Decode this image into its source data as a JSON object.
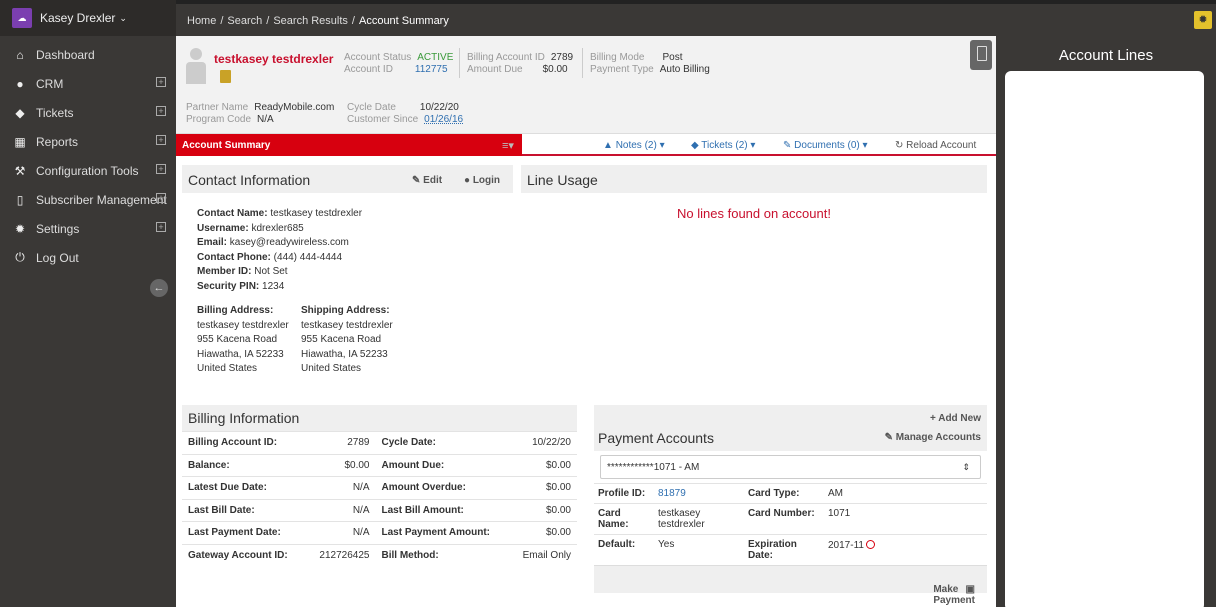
{
  "sidebar": {
    "user_name": "Kasey Drexler",
    "user_chevron": "⌄",
    "items": [
      {
        "label": "Dashboard",
        "icon": "home-icon",
        "expandable": false
      },
      {
        "label": "CRM",
        "icon": "user-icon",
        "expandable": true
      },
      {
        "label": "Tickets",
        "icon": "tag-icon",
        "expandable": true
      },
      {
        "label": "Reports",
        "icon": "table-icon",
        "expandable": true
      },
      {
        "label": "Configuration Tools",
        "icon": "wrench-icon",
        "expandable": true
      },
      {
        "label": "Subscriber Management",
        "icon": "mobile-icon",
        "expandable": true
      },
      {
        "label": "Settings",
        "icon": "gear-icon",
        "expandable": true
      },
      {
        "label": "Log Out",
        "icon": "power-icon",
        "expandable": false
      }
    ]
  },
  "breadcrumb": {
    "items": [
      "Home",
      "Search",
      "Search Results"
    ],
    "current": "Account Summary",
    "separator": "/"
  },
  "header": {
    "customer_name": "testkasey testdrexler",
    "account_status_label": "Account Status",
    "account_status": "ACTIVE",
    "account_id_label": "Account ID",
    "account_id": "112775",
    "billing_account_id_label": "Billing Account ID",
    "billing_account_id": "2789",
    "amount_due_label": "Amount Due",
    "amount_due": "$0.00",
    "billing_mode_label": "Billing Mode",
    "billing_mode": "Post",
    "payment_type_label": "Payment Type",
    "payment_type": "Auto Billing",
    "partner_name_label": "Partner Name",
    "partner_name": "ReadyMobile.com",
    "program_code_label": "Program Code",
    "program_code": "N/A",
    "cycle_date_label": "Cycle Date",
    "cycle_date": "10/22/20",
    "customer_since_label": "Customer Since",
    "customer_since": "01/26/16"
  },
  "tabs": {
    "active": "Account Summary",
    "notes": "Notes (2)",
    "tickets": "Tickets (2)",
    "documents": "Documents (0)",
    "reload": "Reload Account",
    "menu_glyph": "≡▾"
  },
  "contact": {
    "title": "Contact Information",
    "edit": "Edit",
    "login": "Login",
    "fields": [
      {
        "label": "Contact Name:",
        "value": "testkasey testdrexler"
      },
      {
        "label": "Username:",
        "value": "kdrexler685"
      },
      {
        "label": "Email:",
        "value": "kasey@readywireless.com"
      },
      {
        "label": "Contact Phone:",
        "value": "(444) 444-4444"
      },
      {
        "label": "Member ID:",
        "value": "Not Set"
      },
      {
        "label": "Security PIN:",
        "value": "1234"
      }
    ],
    "billing_address_label": "Billing Address:",
    "billing_address": [
      "testkasey testdrexler",
      "955 Kacena Road",
      "Hiawatha, IA 52233",
      "United States"
    ],
    "shipping_address_label": "Shipping Address:",
    "shipping_address": [
      "testkasey testdrexler",
      "955 Kacena Road",
      "Hiawatha, IA 52233",
      "United States"
    ]
  },
  "line_usage": {
    "title": "Line Usage",
    "empty_message": "No lines found on account!"
  },
  "billing": {
    "title": "Billing Information",
    "rows": [
      {
        "l1": "Billing Account ID:",
        "v1": "2789",
        "l2": "Cycle Date:",
        "v2": "10/22/20"
      },
      {
        "l1": "Balance:",
        "v1": "$0.00",
        "l2": "Amount Due:",
        "v2": "$0.00"
      },
      {
        "l1": "Latest Due Date:",
        "v1": "N/A",
        "l2": "Amount Overdue:",
        "v2": "$0.00"
      },
      {
        "l1": "Last Bill Date:",
        "v1": "N/A",
        "l2": "Last Bill Amount:",
        "v2": "$0.00"
      },
      {
        "l1": "Last Payment Date:",
        "v1": "N/A",
        "l2": "Last Payment Amount:",
        "v2": "$0.00"
      },
      {
        "l1": "Gateway Account ID:",
        "v1": "212726425",
        "l2": "Bill Method:",
        "v2": "Email Only"
      }
    ]
  },
  "payment": {
    "title": "Payment Accounts",
    "add_new": "Add New",
    "manage": "Manage Accounts",
    "selected_account": "************1071 - AM",
    "profile_id_label": "Profile ID:",
    "profile_id": "81879",
    "card_type_label": "Card Type:",
    "card_type": "AM",
    "card_name_label_1": "Card",
    "card_name_label_2": "Name:",
    "card_name_1": "testkasey",
    "card_name_2": "testdrexler",
    "card_number_label": "Card Number:",
    "card_number": "1071",
    "default_label": "Default:",
    "default": "Yes",
    "expiration_label_1": "Expiration",
    "expiration_label_2": "Date:",
    "expiration": "2017-11",
    "make_payment": "Make Payment"
  },
  "right_panel": {
    "title": "Account Lines"
  }
}
